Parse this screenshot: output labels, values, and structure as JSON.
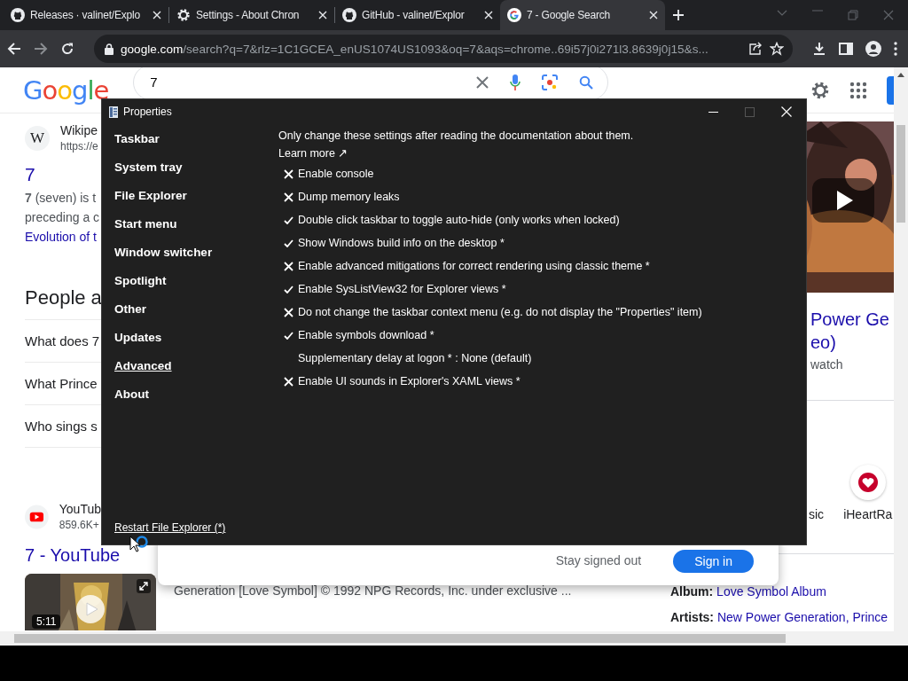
{
  "browser": {
    "tabs": [
      {
        "kind": "github",
        "title": "Releases · valinet/Explo",
        "selected": false
      },
      {
        "kind": "gear",
        "title": "Settings - About Chron",
        "selected": false
      },
      {
        "kind": "github",
        "title": "GitHub - valinet/Explor",
        "selected": false
      },
      {
        "kind": "google",
        "title": "7 - Google Search",
        "selected": true
      }
    ],
    "address": {
      "host": "google.com",
      "path": "/search?q=7&rlz=1C1GCEA_enUS1074US1093&oq=7&aqs=chrome..69i57j0i271l3.8639j0j15&s..."
    }
  },
  "google": {
    "logo": "Google",
    "search": {
      "value": "7"
    },
    "left": {
      "source": {
        "letter": "W",
        "name": "Wikipe",
        "url": "https://e"
      },
      "title": "7",
      "snippet": [
        "**7** (seven) is t",
        "preceding a c"
      ],
      "snippet_link": "Evolution of t",
      "people_heading": "People a",
      "questions": [
        "What does 7",
        "What Prince",
        "Who sings s"
      ],
      "video_source": {
        "name": "YouTub",
        "count": "859.6K+"
      },
      "video_title": "7 - YouTube",
      "video_duration": "5:11"
    },
    "popup": {
      "secondary": "Stay signed out",
      "primary": "Sign in"
    },
    "description": "Generation [Love Symbol] © 1992 NPG Records, Inc. under exclusive ...",
    "right": {
      "title_lines": [
        "Power Ge",
        "eo)"
      ],
      "breadcrumb": "watch",
      "services": [
        {
          "kind": "label",
          "label": "sic"
        },
        {
          "kind": "iheart",
          "label": "iHeartRa"
        }
      ],
      "details": [
        {
          "label": "Album:",
          "value": "Love Symbol Album"
        },
        {
          "label": "Artists:",
          "value": "New Power Generation, Prince"
        }
      ]
    }
  },
  "dialog": {
    "title": "Properties",
    "sidebar": [
      {
        "label": "Taskbar",
        "selected": false
      },
      {
        "label": "System tray",
        "selected": false
      },
      {
        "label": "File Explorer",
        "selected": false
      },
      {
        "label": "Start menu",
        "selected": false
      },
      {
        "label": "Window switcher",
        "selected": false
      },
      {
        "label": "Spotlight",
        "selected": false
      },
      {
        "label": "Other",
        "selected": false
      },
      {
        "label": "Updates",
        "selected": false
      },
      {
        "label": "Advanced",
        "selected": true
      },
      {
        "label": "About",
        "selected": false
      }
    ],
    "intro": "Only change these settings after reading the documentation about them.",
    "learn_more": "Learn more ↗",
    "options": [
      {
        "kind": "check",
        "label": "Enable console",
        "checked": false
      },
      {
        "kind": "check",
        "label": "Dump memory leaks",
        "checked": false
      },
      {
        "kind": "check",
        "label": "Double click taskbar to toggle auto-hide (only works when locked)",
        "checked": true
      },
      {
        "kind": "check",
        "label": "Show Windows build info on the desktop *",
        "checked": true
      },
      {
        "kind": "check",
        "label": "Enable advanced mitigations for correct rendering using classic theme *",
        "checked": false
      },
      {
        "kind": "check",
        "label": "Enable SysListView32 for Explorer views *",
        "checked": true
      },
      {
        "kind": "check",
        "label": "Do not change the taskbar context menu (e.g. do not display the \"Properties\" item)",
        "checked": false
      },
      {
        "kind": "check",
        "label": "Enable symbols download *",
        "checked": true
      },
      {
        "kind": "choice",
        "label": "Supplementary delay at logon * : None (default)"
      },
      {
        "kind": "check",
        "label": "Enable UI sounds in Explorer's XAML views *",
        "checked": false
      }
    ],
    "footer_link": "Restart File Explorer (*)"
  }
}
